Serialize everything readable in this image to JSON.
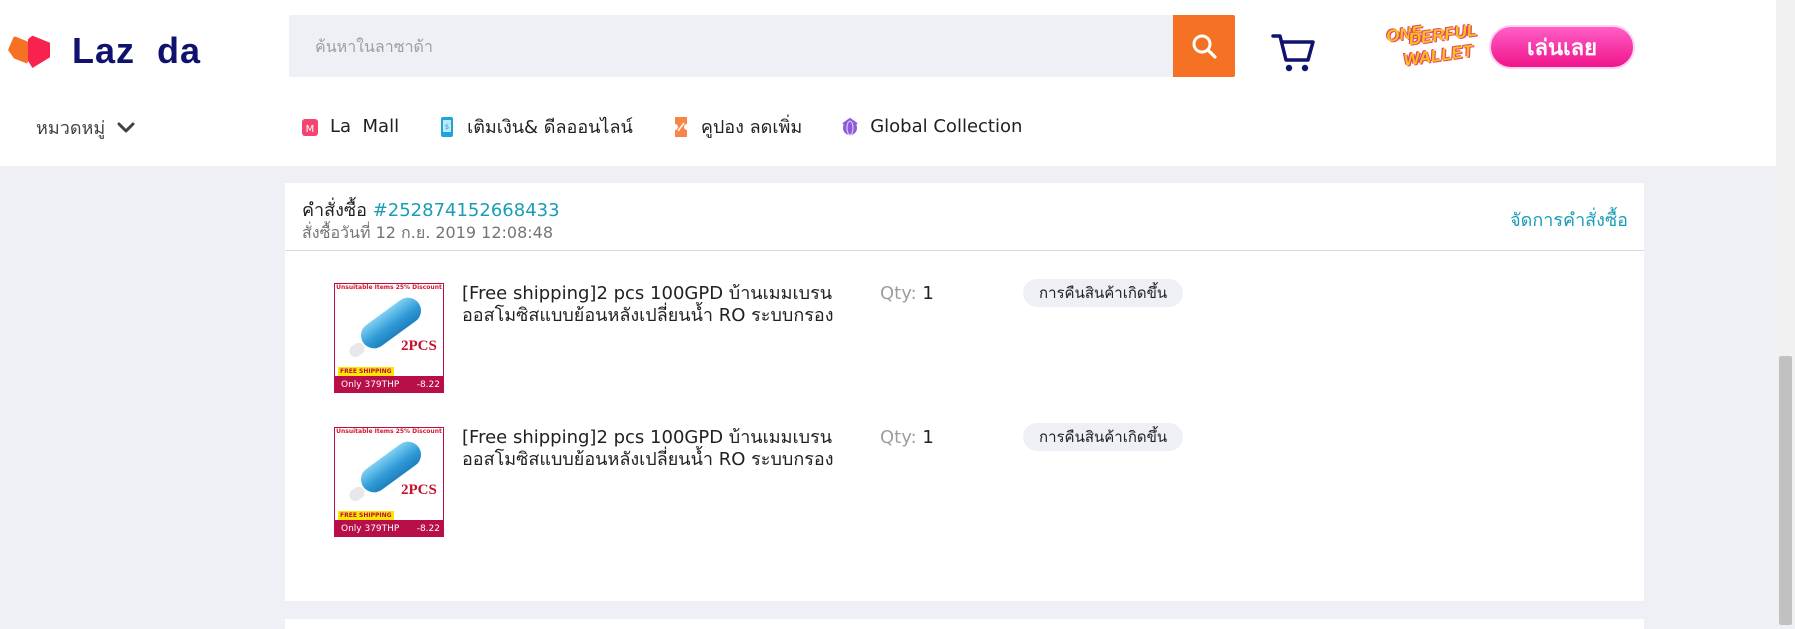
{
  "header": {
    "logo_text": "Laz  da",
    "search": {
      "placeholder": "ค้นหาในลาซาด้า",
      "value": ""
    },
    "promo": {
      "art_line1": "ONE",
      "art_line2": "DERFUL",
      "art_line3": "WALLET",
      "play_label": "เล่นเลย"
    },
    "category_label": "หมวดหมู่",
    "subnav": [
      {
        "label": "La  Mall",
        "icon": "lazmall-icon"
      },
      {
        "label": "เติมเงิน& ดีลออนไลน์",
        "icon": "topup-phone-icon"
      },
      {
        "label": "คูปอง ลดเพิ่ม",
        "icon": "coupon-icon"
      },
      {
        "label": "Global Collection",
        "icon": "global-collection-icon"
      }
    ]
  },
  "order": {
    "label": "คำสั่งซื้อ",
    "id": "#252874152668433",
    "date": "สั่งซื้อวันที่ 12 ก.ย. 2019 12:08:48",
    "manage_label": "จัดการคำสั่งซื้อ",
    "items": [
      {
        "title": "[Free shipping]2 pcs 100GPD บ้านเมมเบรนออสโมซิสแบบย้อนหลังเปลี่ยนน้ำ RO ระบบกรอง",
        "qty_label": "Qty:",
        "qty": "1",
        "status": "การคืนสินค้าเกิดขึ้น",
        "thumb": {
          "banner": "Unsuitable Items 25% Discount",
          "pcs": "2PCS",
          "free": "FREE SHIPPING",
          "only": "Only 379THP",
          "date1": "8.14",
          "date2": "-8.22"
        }
      },
      {
        "title": "[Free shipping]2 pcs 100GPD บ้านเมมเบรนออสโมซิสแบบย้อนหลังเปลี่ยนน้ำ RO ระบบกรอง",
        "qty_label": "Qty:",
        "qty": "1",
        "status": "การคืนสินค้าเกิดขึ้น",
        "thumb": {
          "banner": "Unsuitable Items 25% Discount",
          "pcs": "2PCS",
          "free": "FREE SHIPPING",
          "only": "Only 379THP",
          "date1": "8.14",
          "date2": "-8.22"
        }
      }
    ]
  },
  "colors": {
    "accent": "#f57224",
    "link": "#1a9cb7",
    "page_bg": "#eff0f5",
    "brand_text": "#0f136d"
  }
}
